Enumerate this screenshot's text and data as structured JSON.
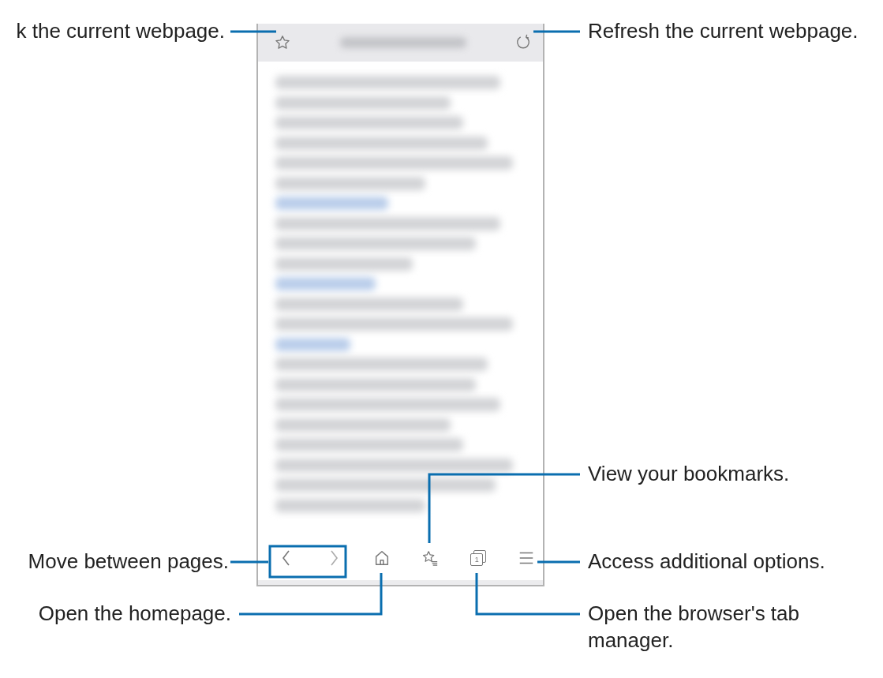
{
  "callouts": [
    {
      "text": "k the current webpage."
    },
    {
      "text": "Refresh the current webpage."
    },
    {
      "text": "View your bookmarks."
    },
    {
      "text": "Move between pages."
    },
    {
      "text": "Access additional options."
    },
    {
      "text": "Open the homepage."
    },
    {
      "text": "Open the browser's tab manager."
    }
  ],
  "toolbar": {
    "tab_count": "1"
  }
}
